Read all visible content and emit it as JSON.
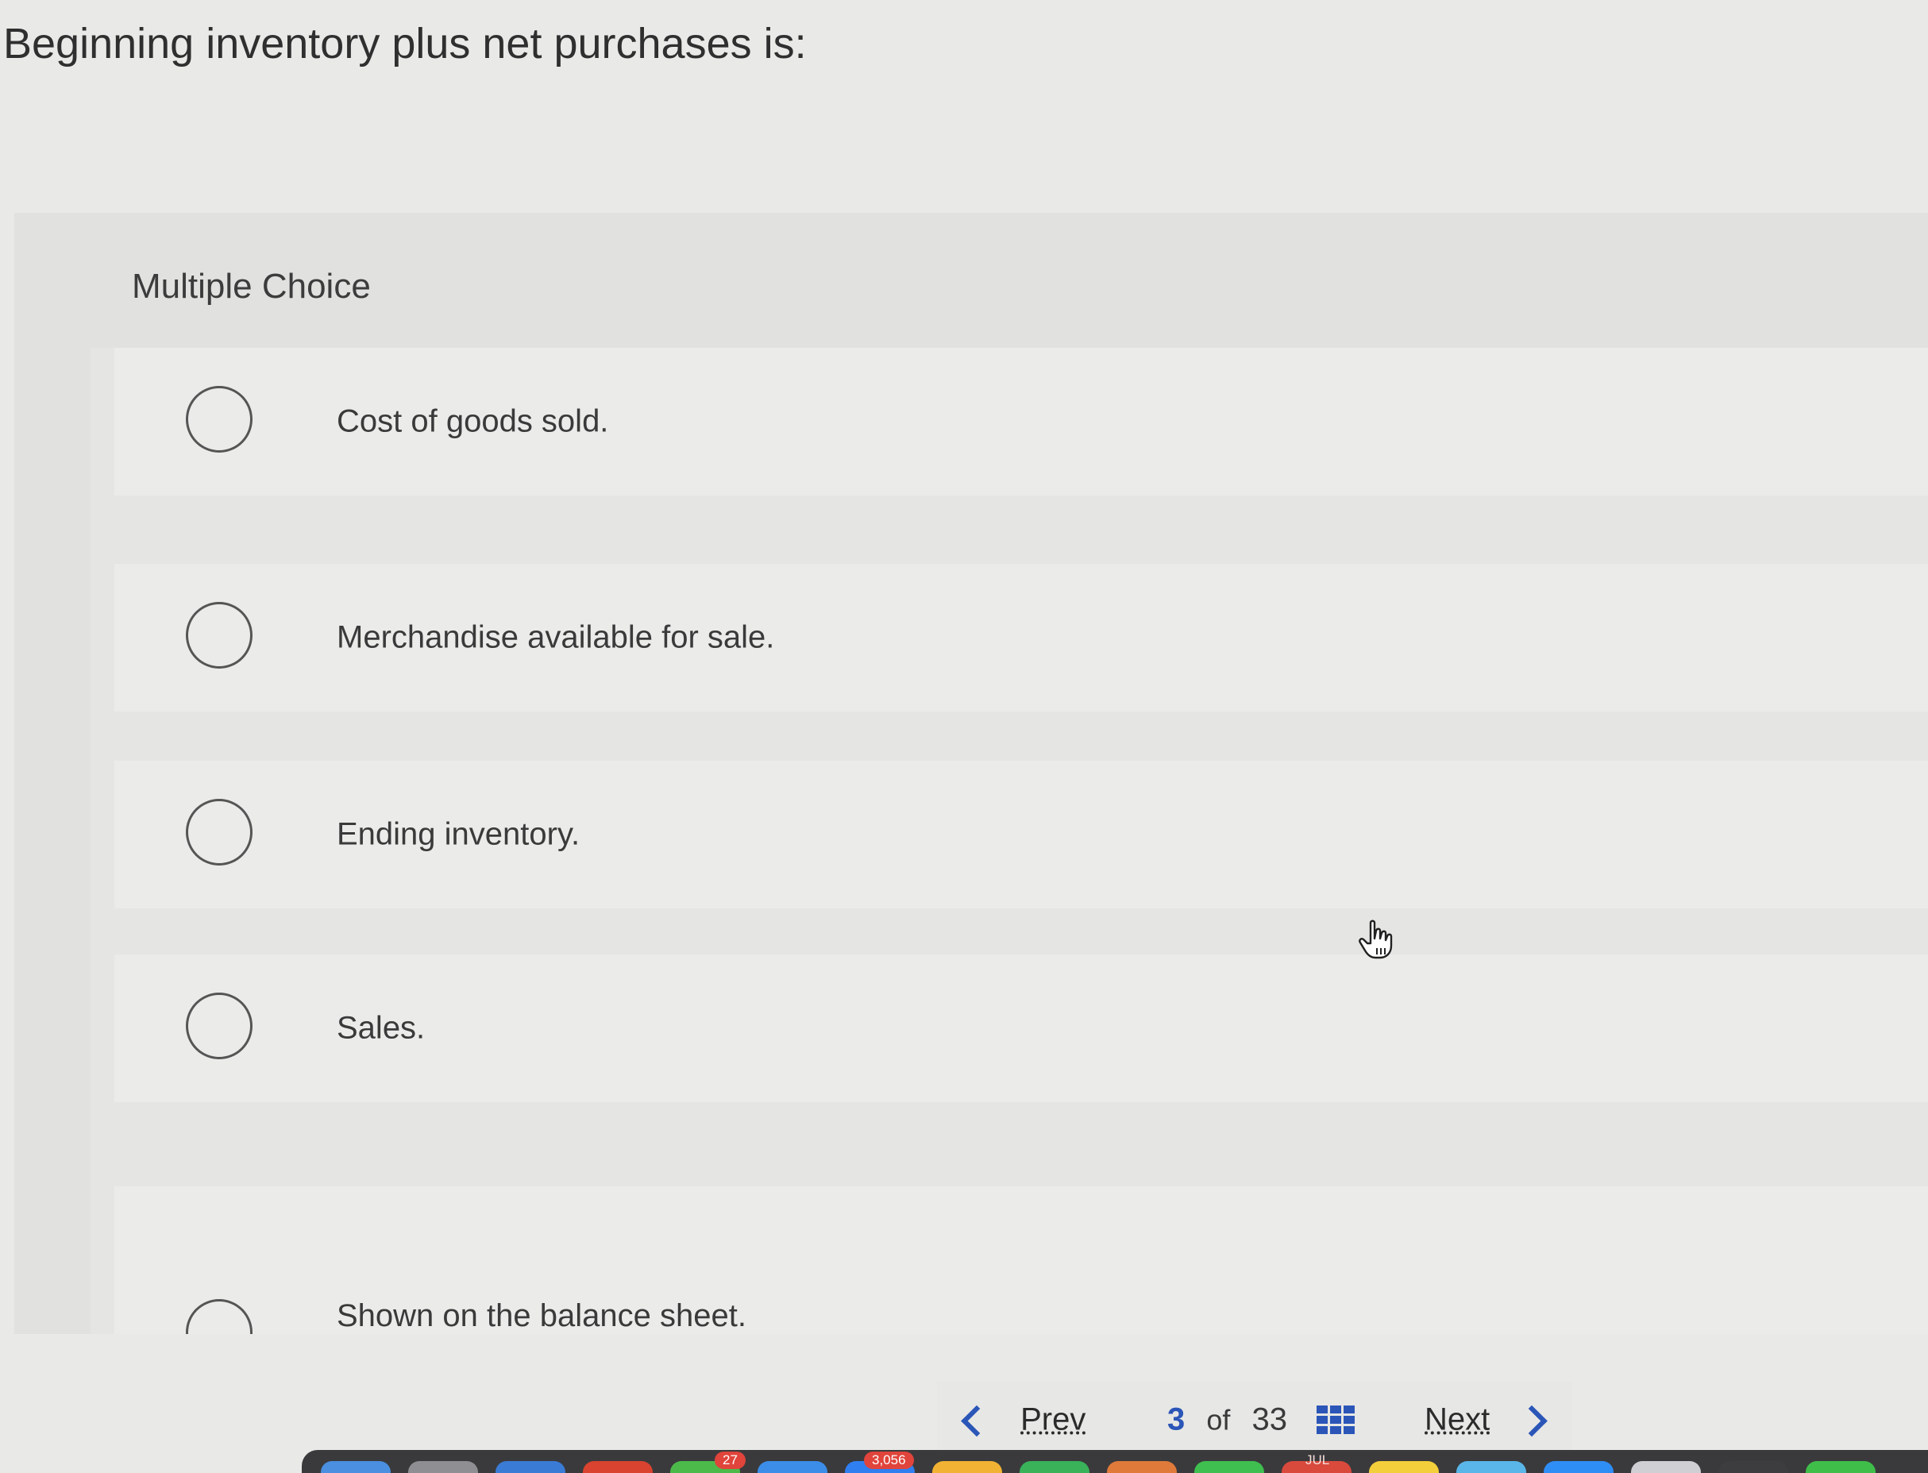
{
  "question": {
    "text": "Beginning inventory plus net purchases is:"
  },
  "multiple_choice": {
    "header": "Multiple Choice",
    "options": [
      {
        "label": "Cost of goods sold."
      },
      {
        "label": "Merchandise available for sale."
      },
      {
        "label": "Ending inventory."
      },
      {
        "label": "Sales."
      },
      {
        "label": "Shown on the balance sheet."
      }
    ]
  },
  "navigation": {
    "prev_label": "Prev",
    "next_label": "Next",
    "current_page": "3",
    "of_label": "of",
    "total_pages": "33"
  },
  "dock": {
    "badges": [
      "27",
      "3,056",
      "JUL"
    ]
  },
  "colors": {
    "accent": "#2b56b8",
    "background": "#e9e9e7",
    "panel": "#e1e1df"
  }
}
